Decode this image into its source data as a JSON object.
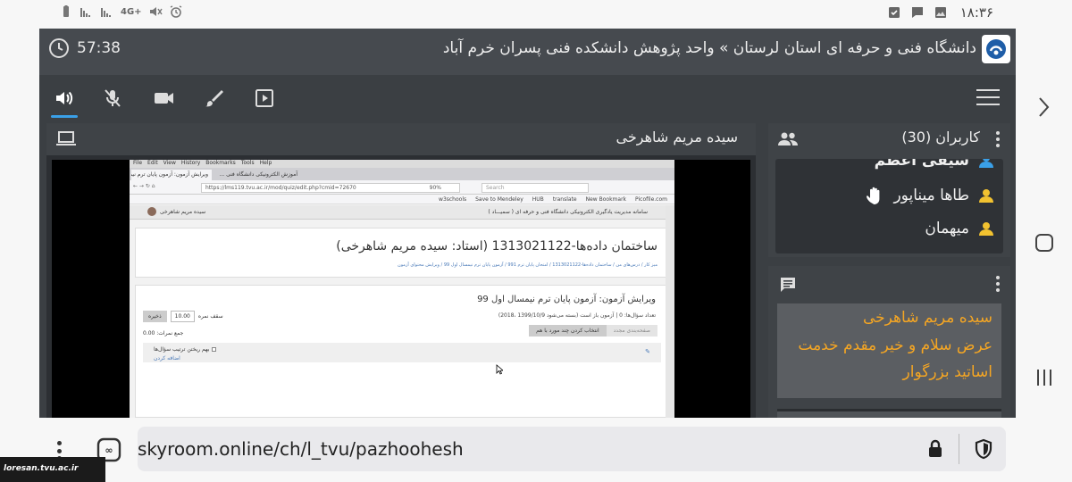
{
  "status_bar": {
    "time": "۱۸:۳۶",
    "network_label": "4G+"
  },
  "app": {
    "session_timer": "57:38",
    "room_title": "دانشگاه فنی و حرفه ای استان لرستان » واحد پژوهش دانشکده فنی پسران خرم آباد"
  },
  "toolbar": {
    "tools": [
      "speaker-icon",
      "mic-muted-icon",
      "camera-icon",
      "brush-icon",
      "play-media-icon"
    ],
    "active_tool": "speaker-icon"
  },
  "share_panel": {
    "presenter_name": "سیده مریم شاهرخی",
    "screen": {
      "browser_menu": [
        "File",
        "Edit",
        "View",
        "History",
        "Bookmarks",
        "Tools",
        "Help"
      ],
      "tab_label": "ویرایش آزمون: آزمون پایان ترم نیم...",
      "tab_label_2": "آموزش الکترونیکی دانشگاه فنی ...",
      "url": "https://lms119.tvu.ac.ir/mod/quiz/edit.php?cmid=72670",
      "zoom": "90%",
      "search_placeholder": "Search",
      "bookmarks": [
        "Picofile.com",
        "New Bookmark",
        "translate",
        "HUB",
        "Save to Mendeley",
        "w3schools"
      ],
      "site_header": "سامانه مدیریت یادگیری الکترونیکی دانشگاه فنی و حرفه ای ( سمیـــاد )",
      "user_name": "سیده مریم شاهرخی",
      "course_title": "ساختمان داده‌ها-1313021122 (استاد: سیده مریم شاهرخی)",
      "breadcrumb": "میز کار / درس‌های من / ساختمان داده‌ها-1313021122 / امتحان پایان ترم 991 / آزمون پایان ترم نیمسال اول 99 / ویرایش محتوای آزمون",
      "quiz_title": "ویرایش آزمون: آزمون پایان ترم نیمسال اول 99",
      "quiz_info": "تعداد سؤال‌ها: 0 | آزمون باز است (بسته می‌شود 1399/10/9 ،2018)",
      "max_grade_label": "سقف نمره",
      "max_grade_value": "10.00",
      "save_label": "ذخیره",
      "total_marks": "جمع نمرات: 0.00",
      "repaginate_label": "صفحه‌بندی مجدد",
      "select_multiple_label": "انتخاب کردن چند مورد با هم",
      "shuffle_label": "بهم ریختن ترتیب سؤال‌ها",
      "add_label": "اضافه کردن"
    }
  },
  "users_panel": {
    "title": "کاربران (30)",
    "users": [
      {
        "name": "سیفی اعظم",
        "hand_raised": false
      },
      {
        "name": "طاها میناپور",
        "hand_raised": true
      },
      {
        "name": "میهمان",
        "hand_raised": false
      }
    ]
  },
  "chat_panel": {
    "sender": "سیده مریم شاهرخی",
    "message_line1": "عرض سلام و خیر مقدم خدمت",
    "message_line2": "اساتید بزرگوار"
  },
  "browser": {
    "url": "skyroom.online/ch/l_tvu/pazhoohesh"
  },
  "watermark": "loresan.tvu.ac.ir",
  "colors": {
    "accent_blue": "#3aa0e8",
    "chat_orange": "#f5a623",
    "user_yellow": "#f2c230",
    "panel_dark": "#3b3f43"
  }
}
